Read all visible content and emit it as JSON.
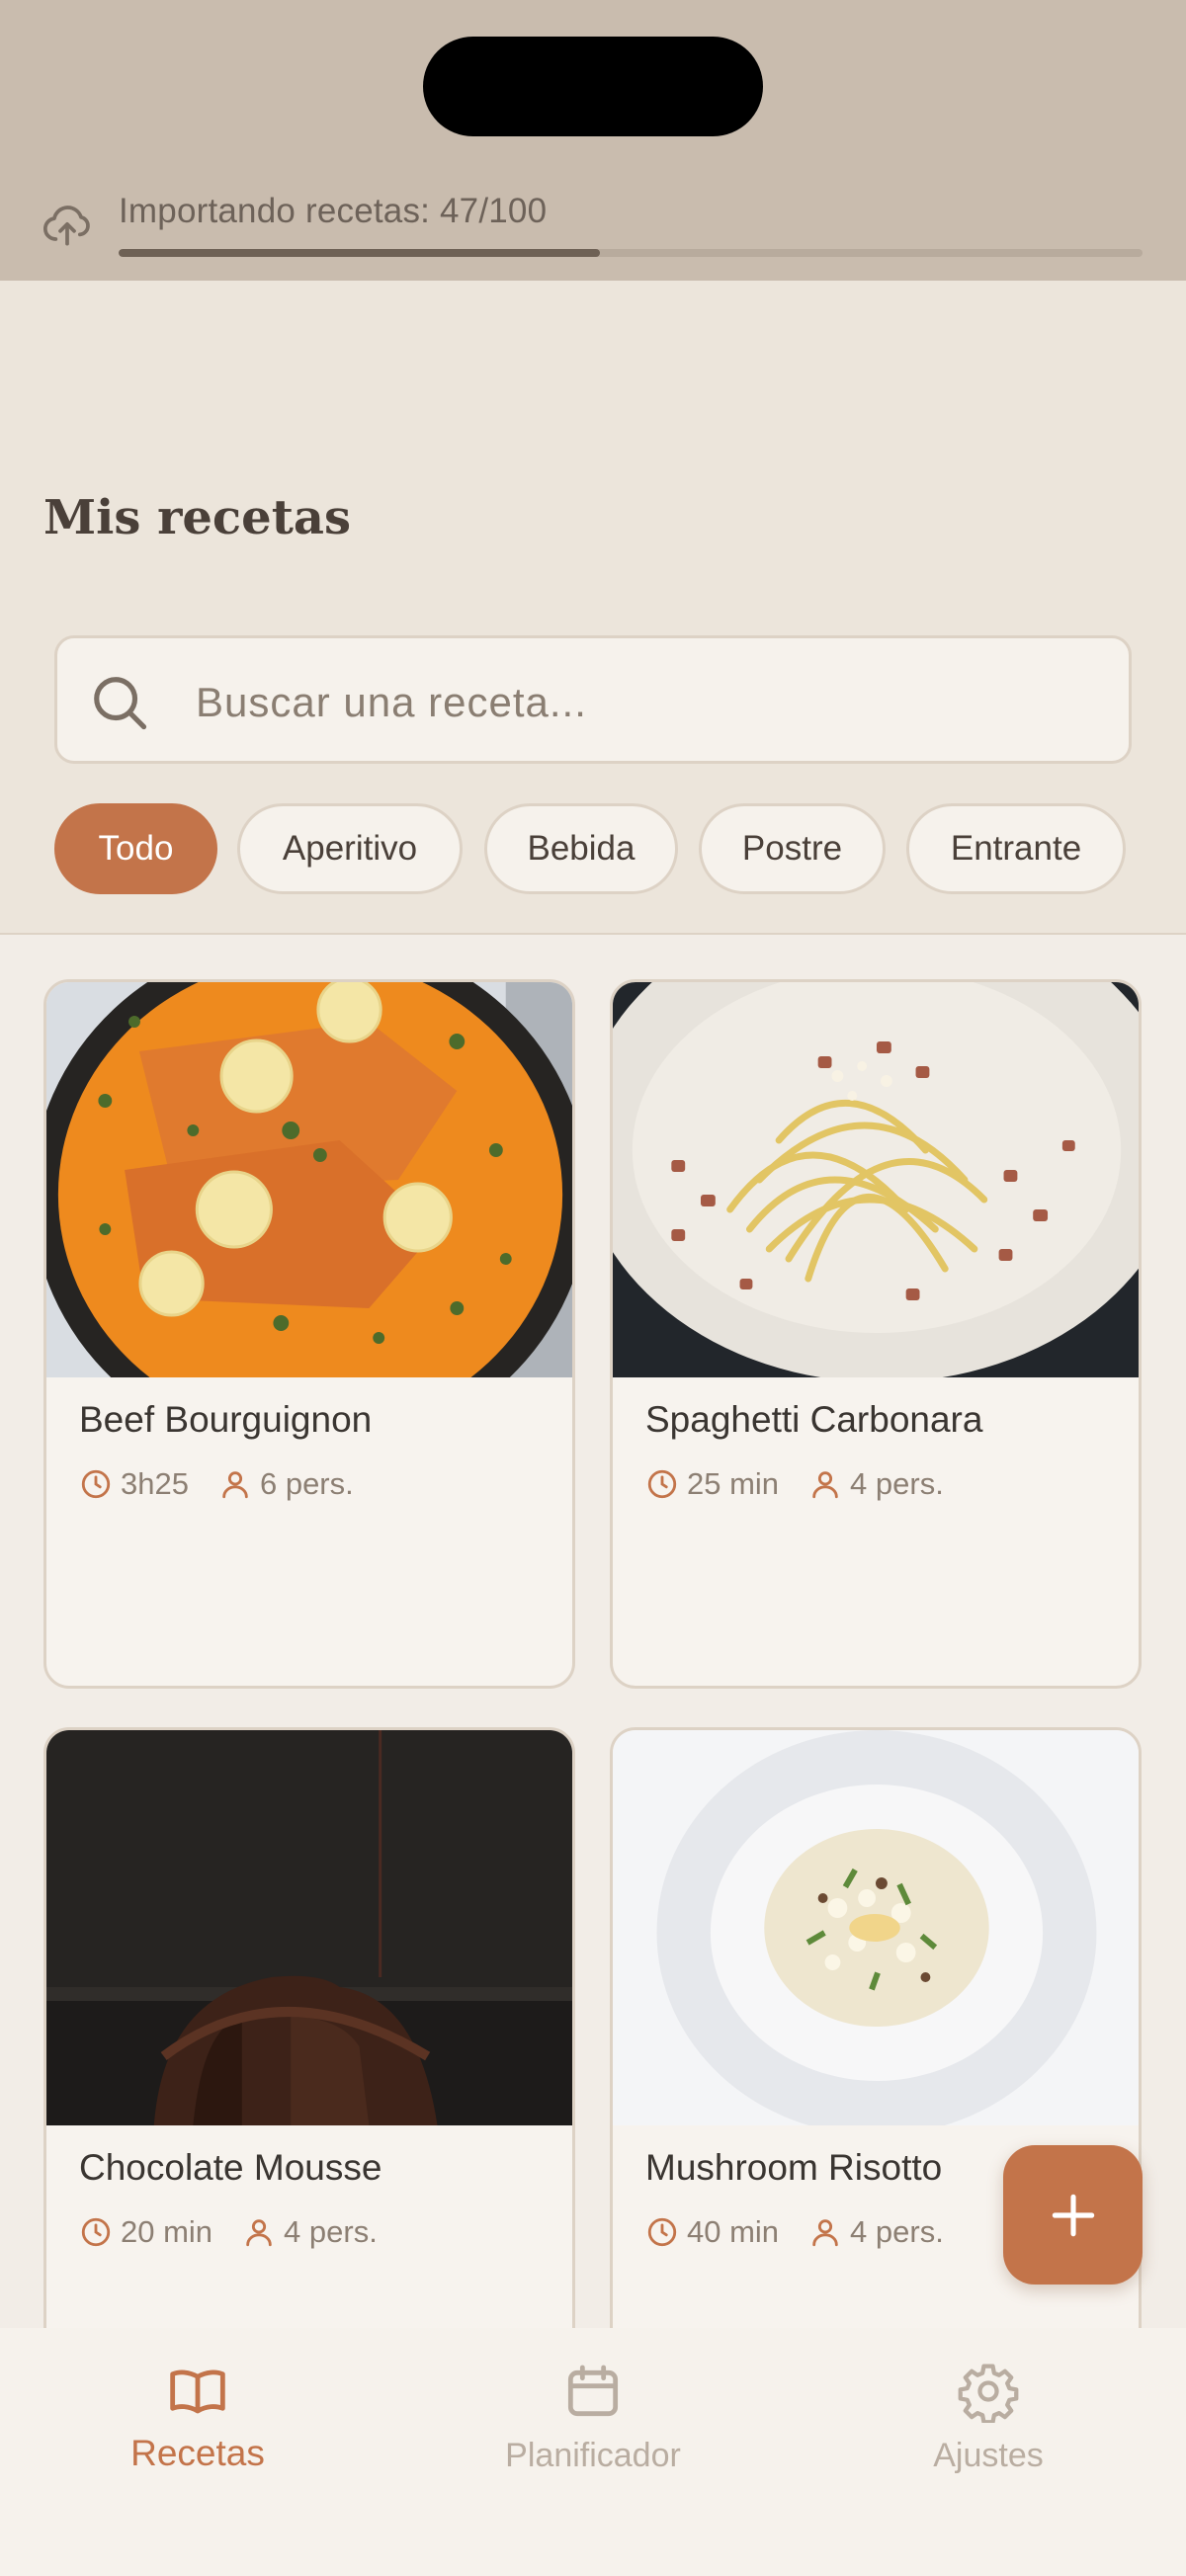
{
  "import_status": {
    "text": "Importando recetas: 47/100",
    "progress_fraction": 0.47
  },
  "header": {
    "title": "Mis recetas"
  },
  "search": {
    "placeholder": "Buscar una receta..."
  },
  "filters": [
    {
      "label": "Todo",
      "active": true
    },
    {
      "label": "Aperitivo",
      "active": false
    },
    {
      "label": "Bebida",
      "active": false
    },
    {
      "label": "Postre",
      "active": false
    },
    {
      "label": "Entrante",
      "active": false
    }
  ],
  "recipes": [
    {
      "title": "Beef Bourguignon",
      "time": "3h25",
      "servings": "6 pers.",
      "image": "salmon-dish-photo"
    },
    {
      "title": "Spaghetti Carbonara",
      "time": "25 min",
      "servings": "4 pers.",
      "image": "carbonara-photo"
    },
    {
      "title": "Chocolate Mousse",
      "time": "20 min",
      "servings": "4 pers.",
      "image": "chocolate-cake-photo"
    },
    {
      "title": "Mushroom Risotto",
      "time": "40 min",
      "servings": "4 pers.",
      "image": "risotto-photo"
    }
  ],
  "nav": [
    {
      "label": "Recetas",
      "icon": "book-open-icon",
      "active": true
    },
    {
      "label": "Planificador",
      "icon": "calendar-icon",
      "active": false
    },
    {
      "label": "Ajustes",
      "icon": "gear-icon",
      "active": false
    }
  ],
  "colors": {
    "accent": "#c3744a",
    "background": "#ece5db",
    "top_band": "#c9bcae",
    "card": "#f7f3ee"
  }
}
